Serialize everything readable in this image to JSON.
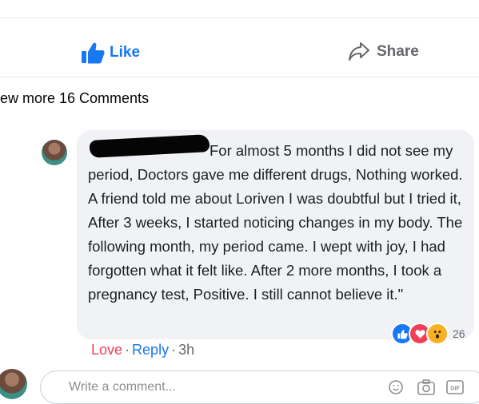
{
  "actions": {
    "like_label": "Like",
    "share_label": "Share"
  },
  "comments": {
    "view_more_label": "ew more 16 Comments"
  },
  "comment": {
    "text": "For almost 5 months I did not see my period, Doctors gave me different drugs, Nothing worked. A friend told me about Loriven I was doubtful but I tried it, After 3 weeks, I started noticing changes in my body. The following month, my period came. I wept with joy, I had forgotten what it felt like. After 2 more months, I took a pregnancy test, Positive. I still cannot believe it.\"",
    "reaction_count": "26",
    "love_label": "Love",
    "reply_label": "Reply",
    "separator": "·",
    "time": "3h"
  },
  "composer": {
    "placeholder": "Write a comment..."
  },
  "colors": {
    "facebook_blue": "#1877f2",
    "love_red": "#f33e58",
    "bubble_bg": "#f0f2f5"
  }
}
